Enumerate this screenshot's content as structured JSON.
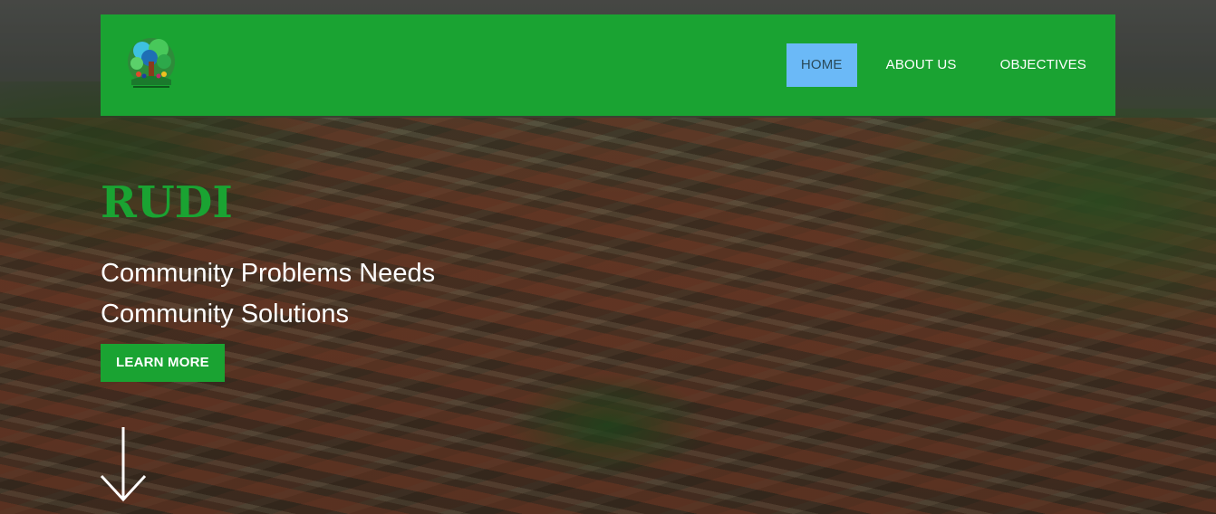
{
  "brand": {
    "logo_icon": "tree-people-logo-icon",
    "colors": {
      "primary": "#1aa332",
      "active_nav": "#6bb9f7"
    }
  },
  "nav": {
    "items": [
      {
        "label": "HOME",
        "active": true
      },
      {
        "label": "ABOUT US",
        "active": false
      },
      {
        "label": "OBJECTIVES",
        "active": false
      }
    ]
  },
  "hero": {
    "title": "RUDI",
    "subtitle_line1": "Community Problems Needs",
    "subtitle_line2": "Community Solutions",
    "cta_label": "LEARN MORE",
    "scroll_icon": "arrow-down-icon"
  }
}
